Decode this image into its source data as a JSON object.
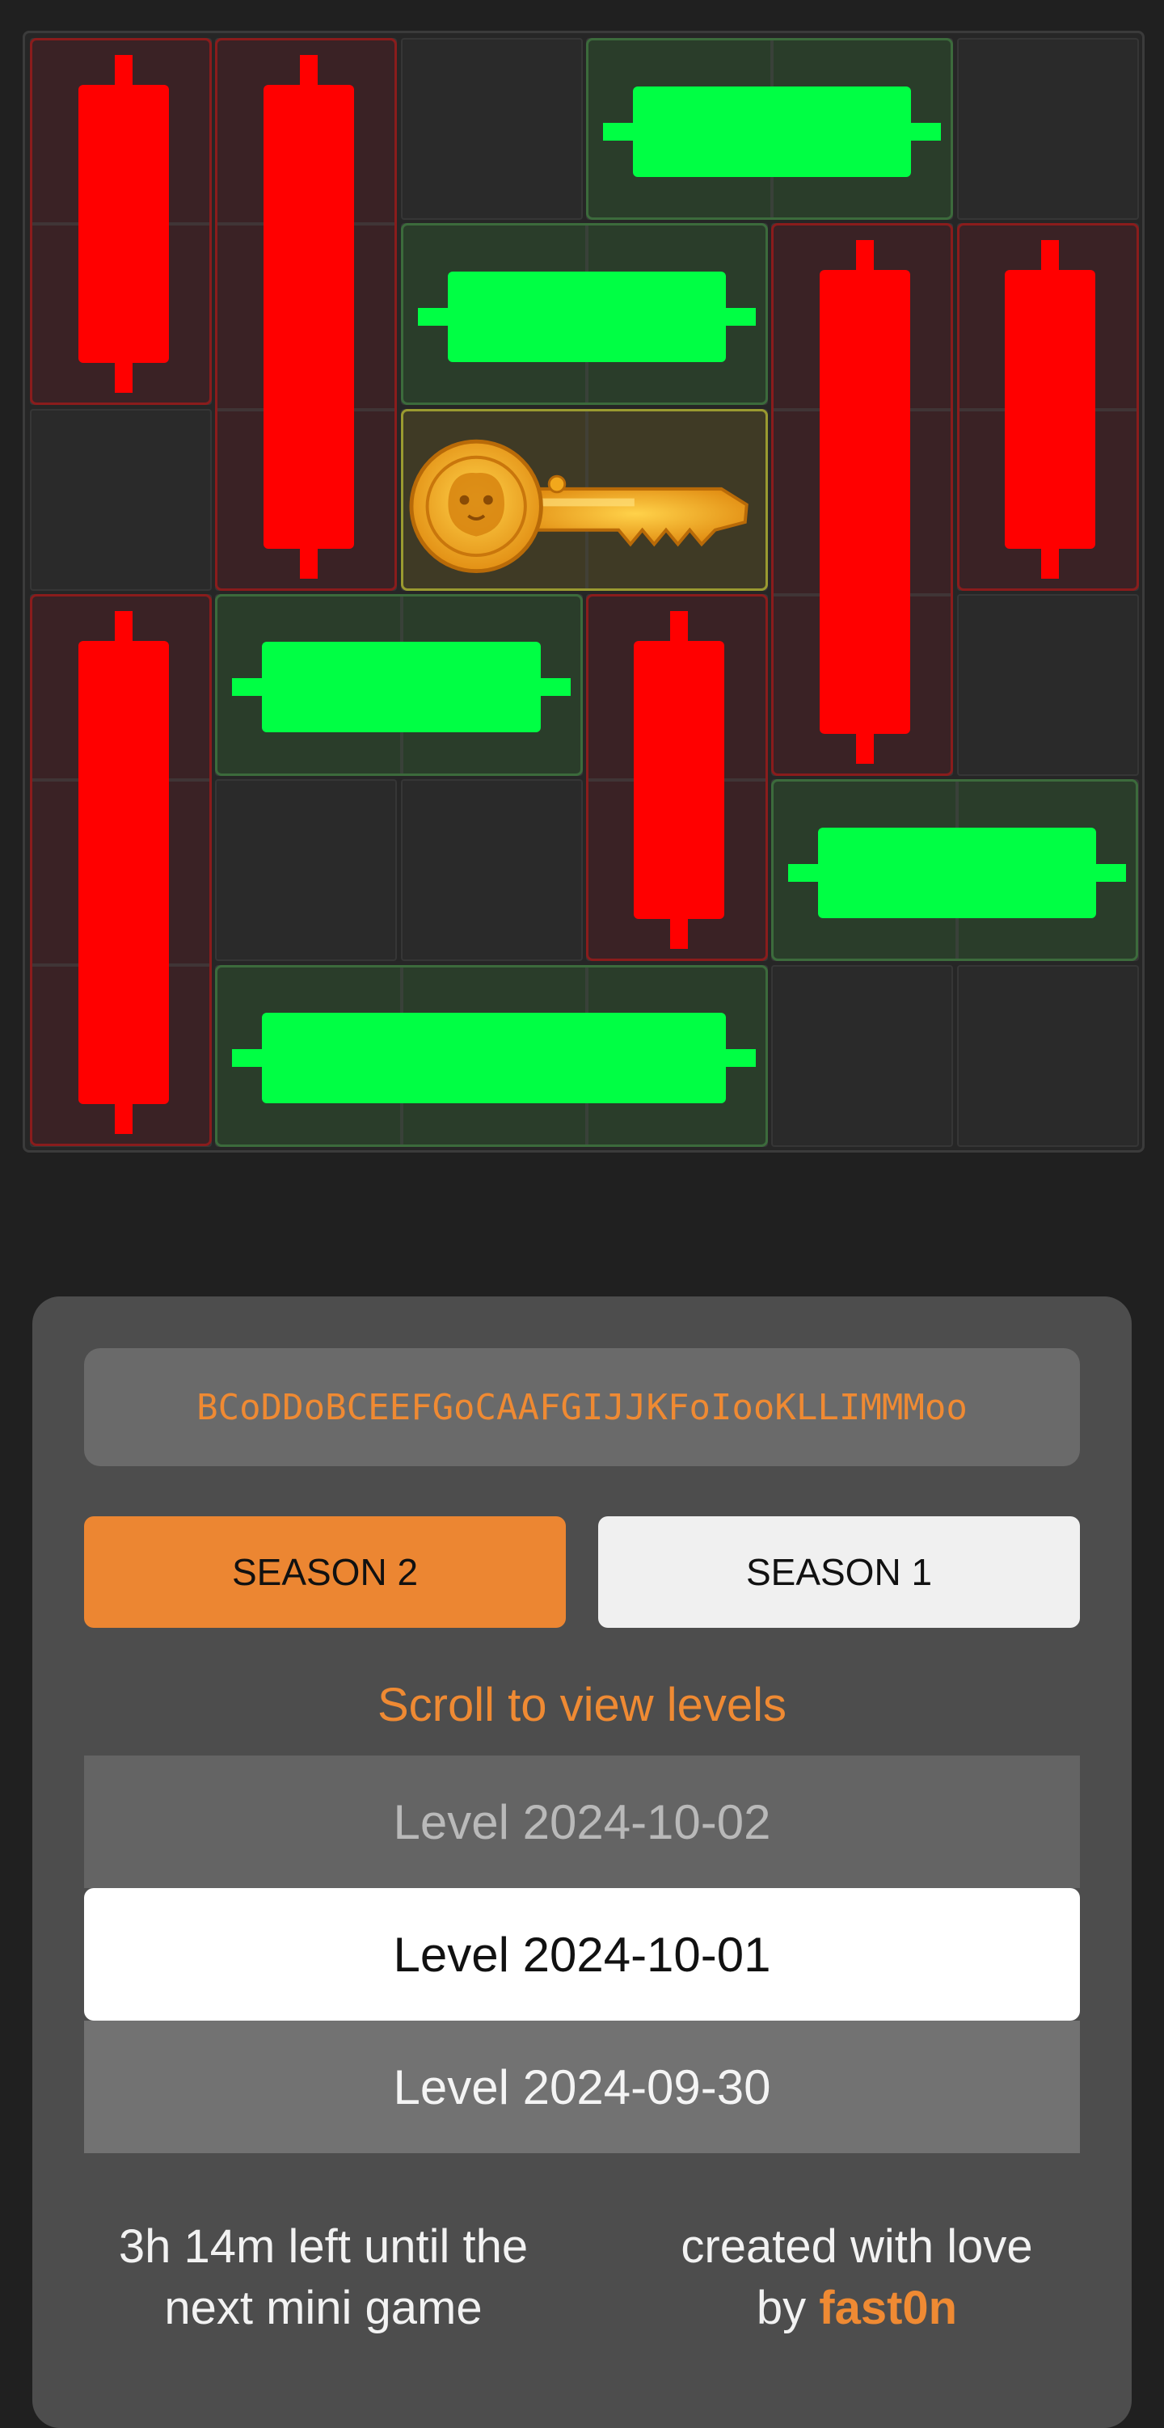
{
  "board": {
    "size": 6,
    "cells_empty_color": "#2a2a2a",
    "pieces": [
      {
        "id": "A",
        "kind": "red",
        "row": 0,
        "col": 0,
        "orient": "v",
        "len": 2
      },
      {
        "id": "B",
        "kind": "red",
        "row": 0,
        "col": 1,
        "orient": "v",
        "len": 3
      },
      {
        "id": "C",
        "kind": "green",
        "row": 0,
        "col": 3,
        "orient": "h",
        "len": 2
      },
      {
        "id": "D",
        "kind": "green",
        "row": 1,
        "col": 2,
        "orient": "h",
        "len": 2
      },
      {
        "id": "E",
        "kind": "red",
        "row": 1,
        "col": 4,
        "orient": "v",
        "len": 3
      },
      {
        "id": "F",
        "kind": "red",
        "row": 1,
        "col": 5,
        "orient": "v",
        "len": 2
      },
      {
        "id": "KEY",
        "kind": "key",
        "row": 2,
        "col": 2,
        "orient": "h",
        "len": 2
      },
      {
        "id": "G",
        "kind": "red",
        "row": 3,
        "col": 0,
        "orient": "v",
        "len": 3
      },
      {
        "id": "H",
        "kind": "green",
        "row": 3,
        "col": 1,
        "orient": "h",
        "len": 2
      },
      {
        "id": "I",
        "kind": "red",
        "row": 3,
        "col": 3,
        "orient": "v",
        "len": 2
      },
      {
        "id": "J",
        "kind": "green",
        "row": 4,
        "col": 4,
        "orient": "h",
        "len": 2
      },
      {
        "id": "K",
        "kind": "green",
        "row": 5,
        "col": 1,
        "orient": "h",
        "len": 3
      }
    ],
    "colors": {
      "red": "#ff0000",
      "green": "#00ff44",
      "key_gold": "#f2a81c"
    }
  },
  "code": "BCoDDoBCEEFGoCAAFGIJJKFoIooKLLIMMMoo",
  "seasons": [
    {
      "label": "SEASON 2",
      "active": true
    },
    {
      "label": "SEASON 1",
      "active": false
    }
  ],
  "scroll_hint": "Scroll to view levels",
  "levels": [
    {
      "label": "Level 2024-10-02",
      "state": "dim"
    },
    {
      "label": "Level 2024-10-01",
      "state": "selected"
    },
    {
      "label": "Level 2024-09-30",
      "state": "next"
    }
  ],
  "footer": {
    "timer_line1": "3h 14m left until the",
    "timer_line2": "next mini game",
    "credit_line1": "created with love",
    "credit_prefix": "by ",
    "credit_author": "fast0n"
  },
  "accent_color": "#ef8a33"
}
